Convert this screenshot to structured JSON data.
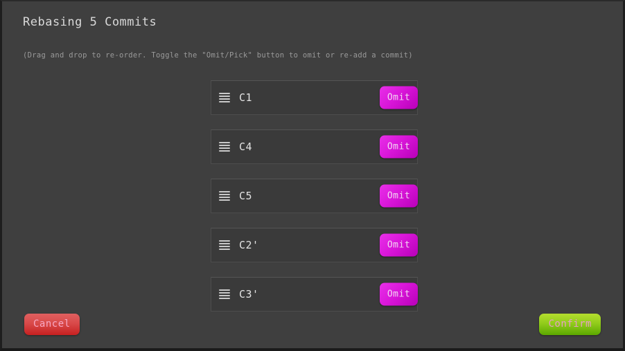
{
  "dialog": {
    "title": "Rebasing 5 Commits",
    "hint": "(Drag and drop to re-order. Toggle the \"Omit/Pick\" button to omit or re-add a commit)"
  },
  "commits": [
    {
      "label": "C1",
      "action_label": "Omit",
      "handle_icon": "drag-handle-icon"
    },
    {
      "label": "C4",
      "action_label": "Omit",
      "handle_icon": "drag-handle-icon"
    },
    {
      "label": "C5",
      "action_label": "Omit",
      "handle_icon": "drag-handle-icon"
    },
    {
      "label": "C2'",
      "action_label": "Omit",
      "handle_icon": "drag-handle-icon"
    },
    {
      "label": "C3'",
      "action_label": "Omit",
      "handle_icon": "drag-handle-icon"
    }
  ],
  "footer": {
    "cancel_label": "Cancel",
    "confirm_label": "Confirm"
  },
  "colors": {
    "background": "#3f3f3f",
    "row_background": "#3a3a3a",
    "row_border": "#4d4d4d",
    "title_text": "#d9d9d9",
    "hint_text": "#9a9a9a",
    "omit_accent": "#d916d9",
    "cancel_accent": "#d94a4a",
    "confirm_accent": "#92cc1c"
  }
}
